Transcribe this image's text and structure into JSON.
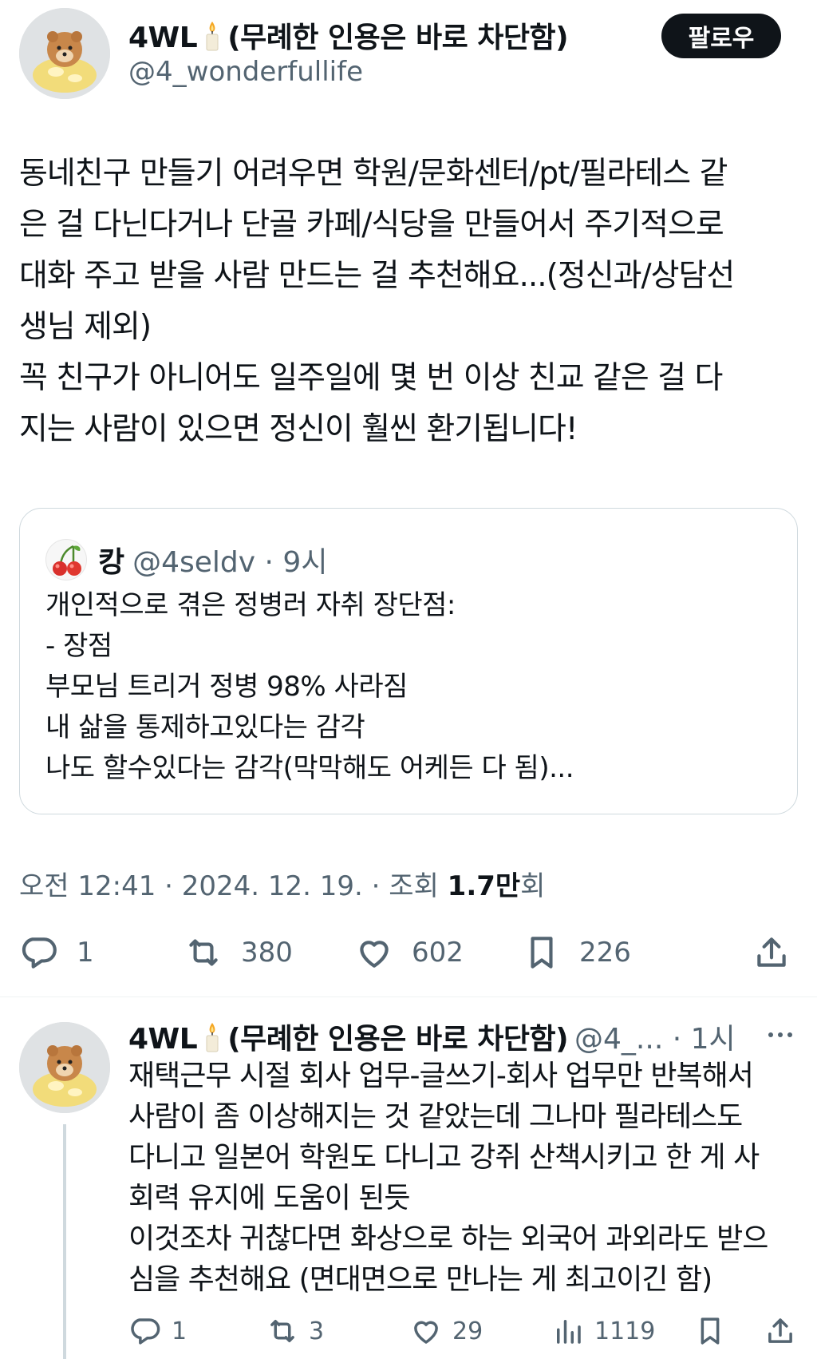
{
  "main_tweet": {
    "author_name": "4WL",
    "author_tag": "(무례한 인용은 바로 차단함)",
    "handle": "@4_wonderfullife",
    "follow_label": "팔로우",
    "body_lines": [
      "동네친구 만들기 어려우면 학원/문화센터/pt/필라테스 같",
      "은 걸 다닌다거나 단골 카페/식당을 만들어서 주기적으로",
      "대화 주고 받을 사람 만드는 걸 추천해요...(정신과/상담선",
      "생님 제외)",
      "꼭 친구가 아니어도 일주일에 몇 번 이상 친교 같은 걸 다",
      "지는 사람이 있으면 정신이 훨씬 환기됩니다!"
    ],
    "timestamp": "오전 12:41 · 2024. 12. 19. · 조회 ",
    "views_number": "1.7",
    "views_unit": "만",
    "views_suffix": "회",
    "stats": {
      "replies": "1",
      "retweets": "380",
      "likes": "602",
      "bookmarks": "226"
    }
  },
  "quote": {
    "name": "캉",
    "handle": "@4seldv · 9시",
    "body_lines": [
      "개인적으로 겪은 정병러 자취 장단점:",
      "- 장점",
      "부모님 트리거 정병 98% 사라짐",
      "내 삶을 통제하고있다는 감각",
      "나도 할수있다는 감각(막막해도 어케든 다 됨)..."
    ]
  },
  "reply": {
    "author_name": "4WL",
    "author_tag": "(무례한 인용은 바로 차단함)",
    "handle_time": "@4_... · 1시",
    "body_lines": [
      "재택근무 시절 회사 업무-글쓰기-회사 업무만 반복해서",
      "사람이 좀 이상해지는 것 같았는데 그나마 필라테스도",
      "다니고 일본어 학원도 다니고 강쥐 산책시키고 한 게 사",
      "회력 유지에 도움이 된듯",
      "이것조차 귀찮다면 화상으로 하는 외국어 과외라도 받으",
      "심을 추천해요 (면대면으로 만나는 게 최고이긴 함)"
    ],
    "stats": {
      "replies": "1",
      "retweets": "3",
      "likes": "29",
      "views": "1119"
    }
  },
  "icons": {
    "reply": "speech-bubble-icon",
    "retweet": "retweet-arrows-icon",
    "like": "heart-icon",
    "bookmark": "bookmark-icon",
    "share": "share-upload-icon",
    "views": "bar-chart-icon",
    "more": "three-dots-icon",
    "candle": "candle-emoji-icon",
    "cherry": "cherry-emoji-icon"
  },
  "colors": {
    "text": "#0f1419",
    "secondary": "#536471",
    "border": "#cfd9de",
    "follow_bg": "#0f1419",
    "follow_text": "#ffffff"
  }
}
